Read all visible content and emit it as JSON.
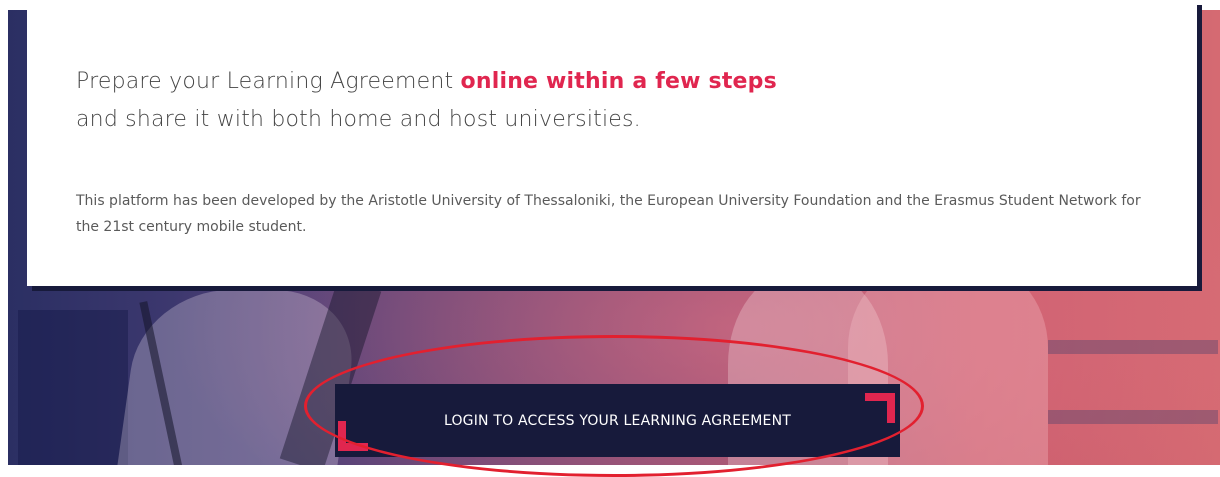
{
  "intro": {
    "line1_prefix": "Prepare your Learning Agreement ",
    "line1_highlight": "online within a few steps",
    "line2": "and share it with both home and host universities."
  },
  "description": "This platform has been developed by the Aristotle University of Thessaloniki, the European University Foundation and the Erasmus Student Network for the 21st century mobile student.",
  "login_button": {
    "label": "LOGIN TO ACCESS YOUR LEARNING AGREEMENT"
  },
  "colors": {
    "accent": "#e0264f",
    "button_bg": "#171a3b",
    "annotation": "#e2202f"
  }
}
